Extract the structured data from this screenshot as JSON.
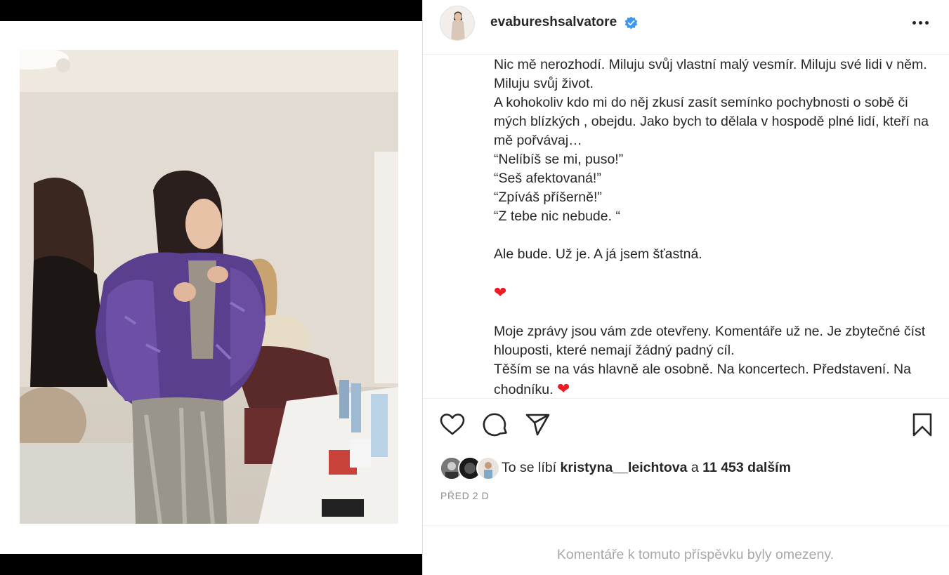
{
  "post": {
    "username": "evabureshsalvatore",
    "verified_icon": "verified-badge-icon",
    "more_icon": "more-options-icon",
    "caption": {
      "p1": "Nic mě nerozhodí. Miluju svůj vlastní malý vesmír. Miluju své lidi v něm. Miluju svůj život.",
      "p2": "A kohokoliv kdo mi do něj zkusí zasít semínko pochybnosti o sobě či mých blízkých , obejdu. Jako bych to dělala v hospodě plné lidí, kteří na mě pořvávaj…",
      "q1": "“Nelíbíš se mi, puso!”",
      "q2": "“Seš afektovaná!”",
      "q3": "“Zpíváš příšerně!”",
      "q4": "“Z tebe nic nebude. “",
      "p3": "Ale bude. Už je. A já jsem šťastná.",
      "heart": "❤",
      "p4": "Moje zprávy jsou vám zde otevřeny. Komentáře už ne. Je zbytečné číst hlouposti, které nemají žádný padný cíl.",
      "p5_text": "Těším se na vás hlavně ale osobně. Na koncertech. Představení. Na chodníku. ",
      "p5_heart": "❤"
    },
    "actions": {
      "like_icon": "heart-outline-icon",
      "comment_icon": "comment-icon",
      "share_icon": "send-icon",
      "save_icon": "bookmark-icon"
    },
    "likes": {
      "prefix": "To se líbí ",
      "user": "kristyna__leichtova",
      "middle": " a ",
      "count": "11 453 dalším"
    },
    "timestamp": "PŘED 2 D",
    "comments_restricted": "Komentáře k tomuto příspěvku byly omezeny."
  },
  "colors": {
    "text": "#262626",
    "secondary": "#8e8e8e",
    "muted": "#a8a8a8",
    "verified": "#3897f0",
    "heart": "#ed1c24"
  }
}
